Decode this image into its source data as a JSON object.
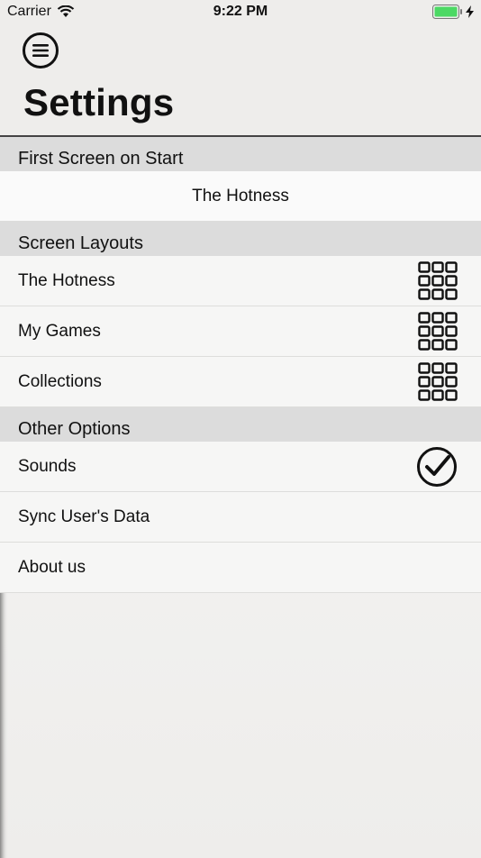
{
  "status_bar": {
    "carrier": "Carrier",
    "time": "9:22 PM"
  },
  "header": {
    "title": "Settings"
  },
  "sections": {
    "first_screen": {
      "header": "First Screen on Start",
      "value": "The Hotness"
    },
    "screen_layouts": {
      "header": "Screen Layouts",
      "items": [
        {
          "label": "The Hotness",
          "icon": "grid-icon"
        },
        {
          "label": "My Games",
          "icon": "grid-icon"
        },
        {
          "label": "Collections",
          "icon": "grid-icon"
        }
      ]
    },
    "other_options": {
      "header": "Other Options",
      "items": [
        {
          "label": "Sounds",
          "icon": "checkmark-icon"
        },
        {
          "label": "Sync User's Data"
        },
        {
          "label": "About us"
        }
      ]
    }
  },
  "colors": {
    "battery": "#4cd964",
    "section_header_bg": "#dcdcdc",
    "page_bg": "#eeedeb"
  }
}
